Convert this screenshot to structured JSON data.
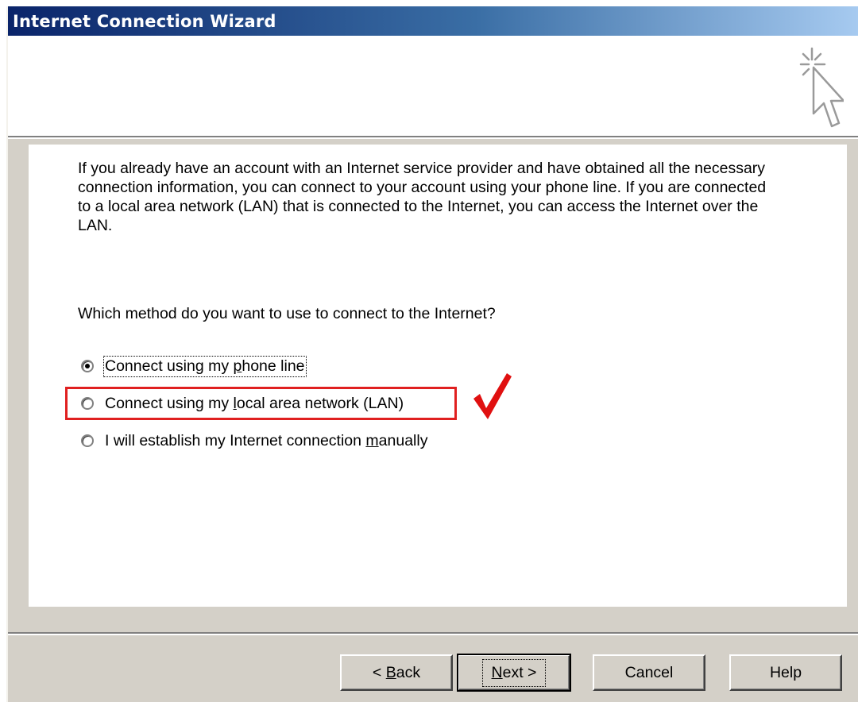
{
  "window": {
    "title": "Internet Connection Wizard"
  },
  "icons": {
    "wizard": "sparkle-cursor-icon",
    "annotation": "red-checkmark-icon"
  },
  "colors": {
    "highlight": "#e02020",
    "title_start": "#0a246a",
    "title_end": "#a6caf0"
  },
  "intro_text": "If you already have an account with an Internet service provider and have obtained all the necessary connection information, you can connect to your account using your phone line. If you are connected to a local area network (LAN) that is connected to the Internet, you can access the Internet over the LAN.",
  "question": "Which method do you want to use to connect to the Internet?",
  "options": [
    {
      "pre": "Connect using my ",
      "key": "p",
      "post": "hone line",
      "checked": true
    },
    {
      "pre": "Connect using my ",
      "key": "l",
      "post": "ocal area network (LAN)",
      "checked": false
    },
    {
      "pre": "I will establish my Internet connection ",
      "key": "m",
      "post": "anually",
      "checked": false
    }
  ],
  "buttons": {
    "back": {
      "pre": "< ",
      "key": "B",
      "post": "ack"
    },
    "next": {
      "pre": "",
      "key": "N",
      "post": "ext >"
    },
    "cancel": "Cancel",
    "help": "Help"
  }
}
